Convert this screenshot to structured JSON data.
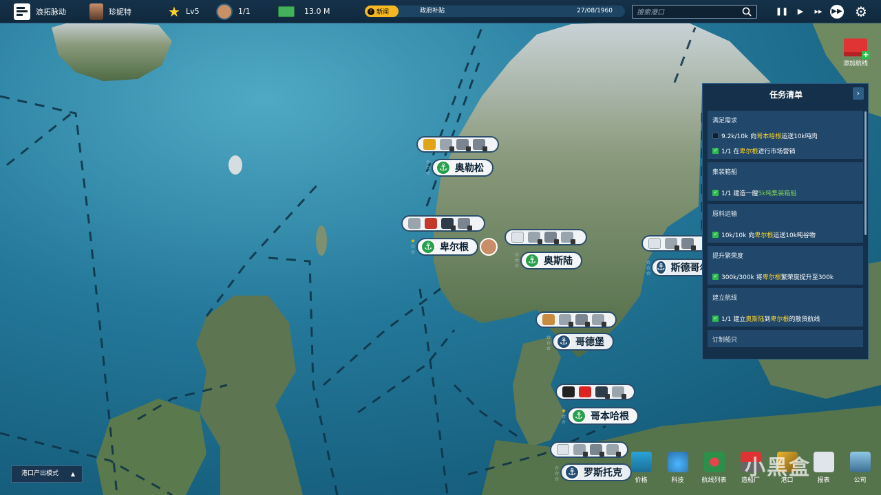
{
  "topbar": {
    "company": "浪拓脉动",
    "player_name": "珍妮特",
    "level": "Lv5",
    "agents": "1/1",
    "money": "13.0 M",
    "news_tag": "新闻",
    "news_text": "政府补贴",
    "date": "27/08/1960",
    "search_placeholder": "搜索港口"
  },
  "map": {
    "add_route_label": "添加航线",
    "ports": [
      {
        "name": "奥勒松",
        "type": "owned",
        "stars": 3
      },
      {
        "name": "卑尔根",
        "type": "owned",
        "stars": 3
      },
      {
        "name": "奥斯陆",
        "type": "owned",
        "stars": 3
      },
      {
        "name": "斯德哥尔",
        "type": "unowned",
        "stars": 3
      },
      {
        "name": "哥德堡",
        "type": "unowned",
        "stars": 3
      },
      {
        "name": "哥本哈根",
        "type": "owned",
        "stars": 3
      },
      {
        "name": "罗斯托克",
        "type": "unowned",
        "stars": 3
      }
    ]
  },
  "task_panel": {
    "title": "任务清单",
    "tasks": [
      {
        "category": "满足需求",
        "lines": [
          {
            "done": false,
            "pre": "9.2k/10k 向",
            "hl": "哥本哈根",
            "post": "运送10k吨肉"
          },
          {
            "done": true,
            "pre": "1/1 在",
            "hl": "卑尔根",
            "post": "进行市场营销"
          }
        ]
      },
      {
        "category": "集装箱船",
        "lines": [
          {
            "done": true,
            "pre": "1/1 建造一艘",
            "hl_green": "5k吨集装箱船",
            "post": ""
          }
        ]
      },
      {
        "category": "原料运输",
        "lines": [
          {
            "done": true,
            "pre": "10k/10k 向",
            "hl": "卑尔根",
            "post": "运送10k吨谷物"
          }
        ]
      },
      {
        "category": "提升繁荣度",
        "lines": [
          {
            "done": true,
            "pre": "300k/300k 将",
            "hl": "卑尔根",
            "post": "繁荣度提升至300k"
          }
        ]
      },
      {
        "category": "建立航线",
        "lines": [
          {
            "done": true,
            "pre": "1/1 建立",
            "hl": "奥斯陆",
            "mid": "到",
            "hl2": "卑尔根",
            "post": "的散货航线"
          }
        ]
      },
      {
        "category": "订制船只",
        "lines": []
      }
    ]
  },
  "bottom": {
    "mode_button": "港口产出模式",
    "dock": [
      "价格",
      "科技",
      "航线列表",
      "造船厂",
      "港口",
      "报表",
      "公司"
    ],
    "watermark": "小黑盒"
  },
  "colors": {
    "sea": "#1f6f8f",
    "land": "#5f7a55",
    "panel": "#15304a",
    "accent_green": "#26a04a",
    "highlight_yellow": "#ffd42a"
  }
}
